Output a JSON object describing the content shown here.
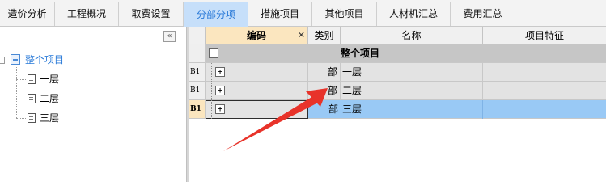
{
  "tabs": [
    {
      "label": "造价分析",
      "active": false
    },
    {
      "label": "工程概况",
      "active": false
    },
    {
      "label": "取费设置",
      "active": false
    },
    {
      "label": "分部分项",
      "active": true
    },
    {
      "label": "措施项目",
      "active": false
    },
    {
      "label": "其他项目",
      "active": false
    },
    {
      "label": "人材机汇总",
      "active": false
    },
    {
      "label": "费用汇总",
      "active": false
    }
  ],
  "tree": {
    "collapse_icon": "double-chevron-left-icon",
    "collapse_glyph": "«",
    "root": {
      "label": "整个项目",
      "icon": "project-folder-icon"
    },
    "children": [
      {
        "label": "一层",
        "icon": "document-icon"
      },
      {
        "label": "二层",
        "icon": "document-icon"
      },
      {
        "label": "三层",
        "icon": "document-icon"
      }
    ]
  },
  "grid": {
    "columns": [
      {
        "label": "编码",
        "selected": true,
        "close_glyph": "✕"
      },
      {
        "label": "类别"
      },
      {
        "label": "名称"
      },
      {
        "label": "项目特征"
      }
    ],
    "rows": [
      {
        "rownum": "",
        "toggle": "−",
        "type": "",
        "name": "整个项目",
        "state": "header"
      },
      {
        "rownum": "B1",
        "toggle": "+",
        "type": "部",
        "name": "一层",
        "state": "normal"
      },
      {
        "rownum": "B1",
        "toggle": "+",
        "type": "部",
        "name": "二层",
        "state": "normal"
      },
      {
        "rownum": "B1",
        "toggle": "+",
        "type": "部",
        "name": "三层",
        "state": "selected"
      }
    ]
  },
  "colors": {
    "active_tab_bg": "#c6dffa",
    "active_tab_text": "#2a7ad8",
    "selected_row": "#99c9f5",
    "header_row": "#c6c6c6",
    "arrow": "#e8332a"
  }
}
